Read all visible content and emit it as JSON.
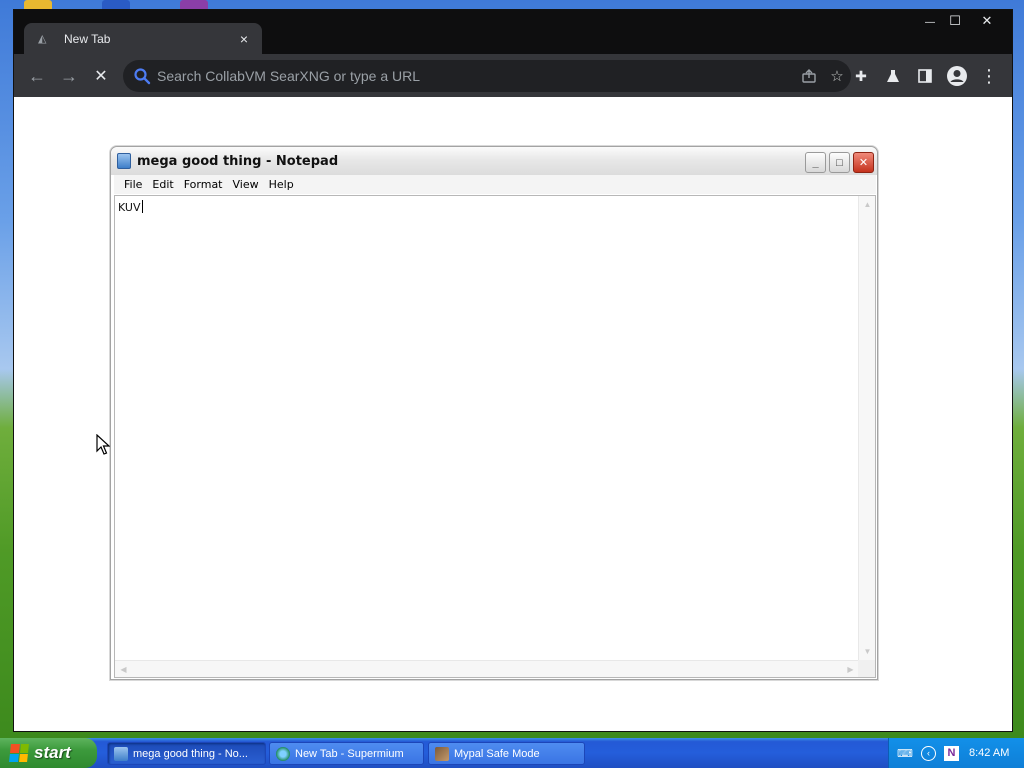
{
  "browser": {
    "tab": {
      "title": "New Tab",
      "favicon": "new-tab-icon",
      "close": "×"
    },
    "window_controls": {
      "minimize": "—",
      "maximize": "☐",
      "close": "✕"
    },
    "toolbar": {
      "back": "←",
      "forward": "→",
      "stop": "✕",
      "omnibox_placeholder": "Search CollabVM SearXNG or type a URL",
      "icons": [
        "share-icon",
        "bookmark-star-icon",
        "extensions-icon",
        "labs-flask-icon",
        "side-panel-icon",
        "profile-icon",
        "menu-dots-icon"
      ]
    }
  },
  "notepad": {
    "title": "mega good thing - Notepad",
    "menu": [
      "File",
      "Edit",
      "Format",
      "View",
      "Help"
    ],
    "content": "KUV"
  },
  "taskbar": {
    "start_label": "start",
    "tasks": [
      {
        "label": "mega good thing - No...",
        "active": true
      },
      {
        "label": "New Tab - Supermium",
        "active": false
      },
      {
        "label": "Mypal Safe Mode",
        "active": false
      }
    ],
    "clock": "8:42 AM",
    "tray_icons": [
      "keyboard-icon",
      "arrow-collapse-icon",
      "onenote-icon"
    ]
  },
  "colors": {
    "browser_frame": "#202124",
    "taskbar": "#245edb",
    "start_button": "#3c9a3c",
    "tray": "#0f7fd7"
  }
}
